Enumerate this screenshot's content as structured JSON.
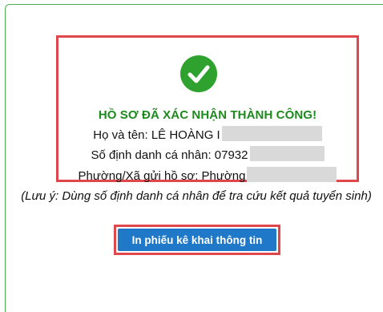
{
  "result": {
    "title": "HỒ SƠ ĐÃ XÁC NHẬN THÀNH CÔNG!",
    "icon": "check-circle-icon",
    "name_label": "Họ và tên: LÊ HOÀNG I",
    "id_label": "Số định danh cá nhân: 07932",
    "ward_label": "Phường/Xã gửi hồ sơ: Phường"
  },
  "note": "(Lưu ý: Dùng số định danh cá nhân để tra cứu kết quả tuyển sinh)",
  "actions": {
    "print_label": "In phiếu kê khai thông tin"
  },
  "colors": {
    "success": "#2ea12e",
    "highlight_border": "#e0474c",
    "button": "#1f78c8",
    "panel_border": "#4caf50"
  }
}
